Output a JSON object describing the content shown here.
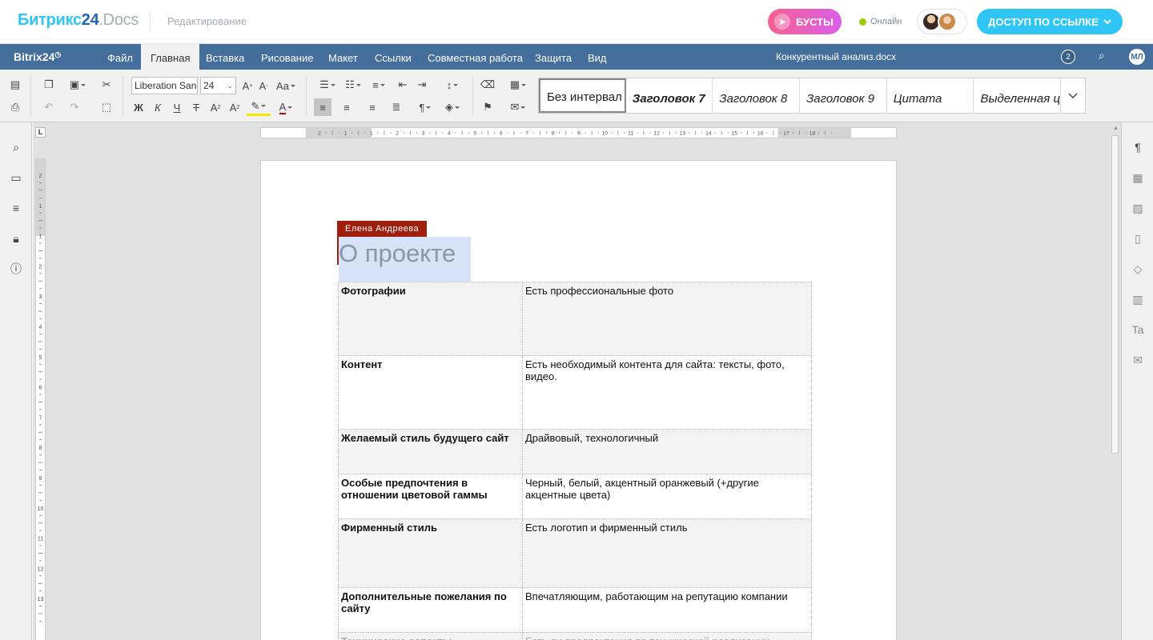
{
  "topbar": {
    "logo_main": "Битрикс",
    "logo_num": "24",
    "logo_docs": ".Docs",
    "mode": "Редактирование",
    "busty": "БУСТЫ",
    "online": "Онлайн",
    "share": "ДОСТУП ПО ССЫЛКЕ"
  },
  "menubar": {
    "brand": "Bitrix24",
    "tabs": [
      "Файл",
      "Главная",
      "Вставка",
      "Рисование",
      "Макет",
      "Ссылки",
      "Совместная работа",
      "Защита",
      "Вид"
    ],
    "active_tab": "Главная",
    "doc_name": "Конкурентный анализ.docx",
    "collab_count": "2",
    "user_initials": "МЛ"
  },
  "toolbar": {
    "font": "Liberation Sans",
    "size": "24",
    "styles": [
      "Без интервал",
      "Заголовок 7",
      "Заголовок 8",
      "Заголовок 9",
      "Цитата",
      "Выделенная ц"
    ]
  },
  "ruler": {
    "marks": [
      "2",
      "1",
      "1",
      "2",
      "3",
      "4",
      "5",
      "6",
      "7",
      "8",
      "9",
      "10",
      "11",
      "12",
      "13",
      "14",
      "15",
      "16",
      "17",
      "18"
    ],
    "vmarks": [
      "2",
      "1",
      "1",
      "2",
      "3",
      "4",
      "5",
      "6",
      "7",
      "8",
      "9",
      "10",
      "11",
      "12",
      "13"
    ]
  },
  "document": {
    "author": "Елена Андреева",
    "heading": "О проекте",
    "rows": [
      {
        "k": "Фотографии",
        "v": "Есть профессиональные фото"
      },
      {
        "k": "Контент",
        "v": "Есть необходимый контента для сайта: тексты, фото, видео."
      },
      {
        "k": "Желаемый стиль будущего сайт",
        "v": "Драйвовый, технологичный"
      },
      {
        "k": "Особые предпочтения в отношении цветовой гаммы",
        "v": "Черный, белый, акцентный оранжевый (+другие акцентные цвета)"
      },
      {
        "k": "Фирменный стиль",
        "v": "Есть логотип и фирменный стиль"
      },
      {
        "k": "Дополнительные пожелания по сайту",
        "v": "Впечатляющим, работающим на репутацию компании"
      },
      {
        "k": "Технические аспекты",
        "v": "Есть ли предпочтения по технической реализации"
      }
    ]
  },
  "colors": {
    "menubar": "#446e9b",
    "accent": "#2fc6f6",
    "author_tag": "#a01e0c",
    "selection": "#d6e2f7"
  }
}
